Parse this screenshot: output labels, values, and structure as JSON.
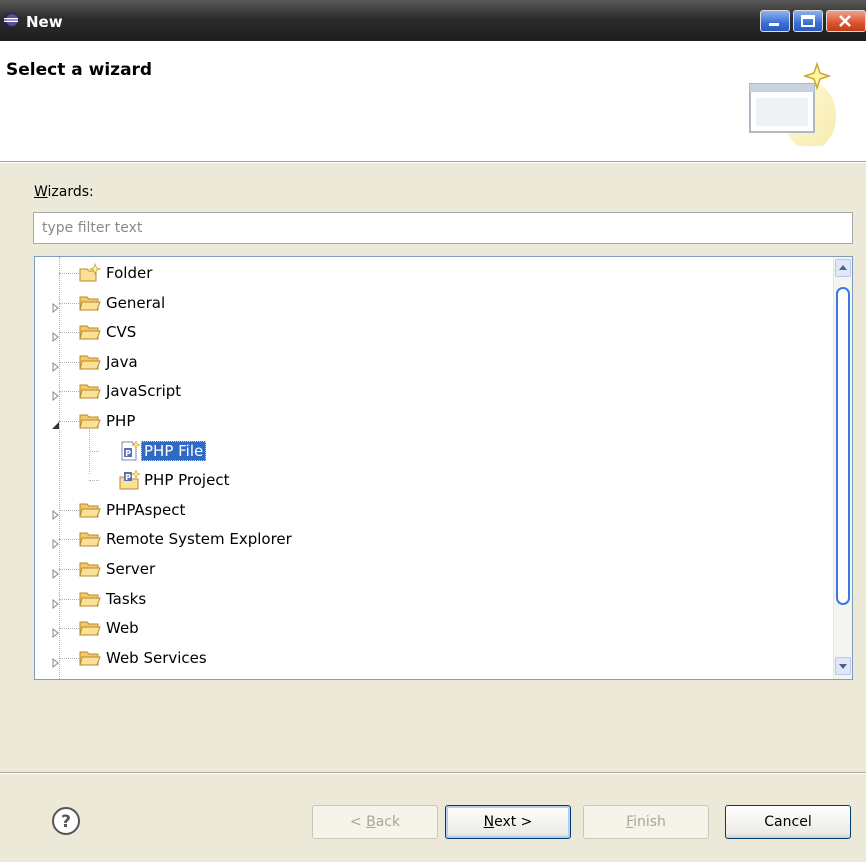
{
  "window": {
    "title": "New"
  },
  "header": {
    "title": "Select a wizard"
  },
  "wizards_label": {
    "mnemonic": "W",
    "rest": "izards:"
  },
  "filter": {
    "placeholder": "type filter text",
    "value": ""
  },
  "tree": {
    "items": [
      {
        "label": "Folder",
        "level": 0,
        "expander": "none",
        "icon": "folder-new-icon"
      },
      {
        "label": "General",
        "level": 0,
        "expander": "collapsed",
        "icon": "folder-icon"
      },
      {
        "label": "CVS",
        "level": 0,
        "expander": "collapsed",
        "icon": "folder-icon"
      },
      {
        "label": "Java",
        "level": 0,
        "expander": "collapsed",
        "icon": "folder-icon"
      },
      {
        "label": "JavaScript",
        "level": 0,
        "expander": "collapsed",
        "icon": "folder-icon"
      },
      {
        "label": "PHP",
        "level": 0,
        "expander": "expanded",
        "icon": "folder-icon"
      },
      {
        "label": "PHP File",
        "level": 1,
        "expander": "none",
        "icon": "php-file-icon",
        "selected": true
      },
      {
        "label": "PHP Project",
        "level": 1,
        "expander": "none",
        "icon": "php-project-icon"
      },
      {
        "label": "PHPAspect",
        "level": 0,
        "expander": "collapsed",
        "icon": "folder-icon"
      },
      {
        "label": "Remote System Explorer",
        "level": 0,
        "expander": "collapsed",
        "icon": "folder-icon"
      },
      {
        "label": "Server",
        "level": 0,
        "expander": "collapsed",
        "icon": "folder-icon"
      },
      {
        "label": "Tasks",
        "level": 0,
        "expander": "collapsed",
        "icon": "folder-icon"
      },
      {
        "label": "Web",
        "level": 0,
        "expander": "collapsed",
        "icon": "folder-icon"
      },
      {
        "label": "Web Services",
        "level": 0,
        "expander": "collapsed",
        "icon": "folder-icon"
      }
    ]
  },
  "buttons": {
    "back": {
      "mnemonic": "B",
      "prefix": "< ",
      "rest": "ack"
    },
    "next": {
      "mnemonic": "N",
      "rest": "ext >"
    },
    "finish": {
      "mnemonic": "F",
      "rest": "inish"
    },
    "cancel": "Cancel"
  },
  "colors": {
    "selection": "#316ac5",
    "titlebar": "#2c2c2c",
    "dialog_bg": "#ece9d8"
  }
}
